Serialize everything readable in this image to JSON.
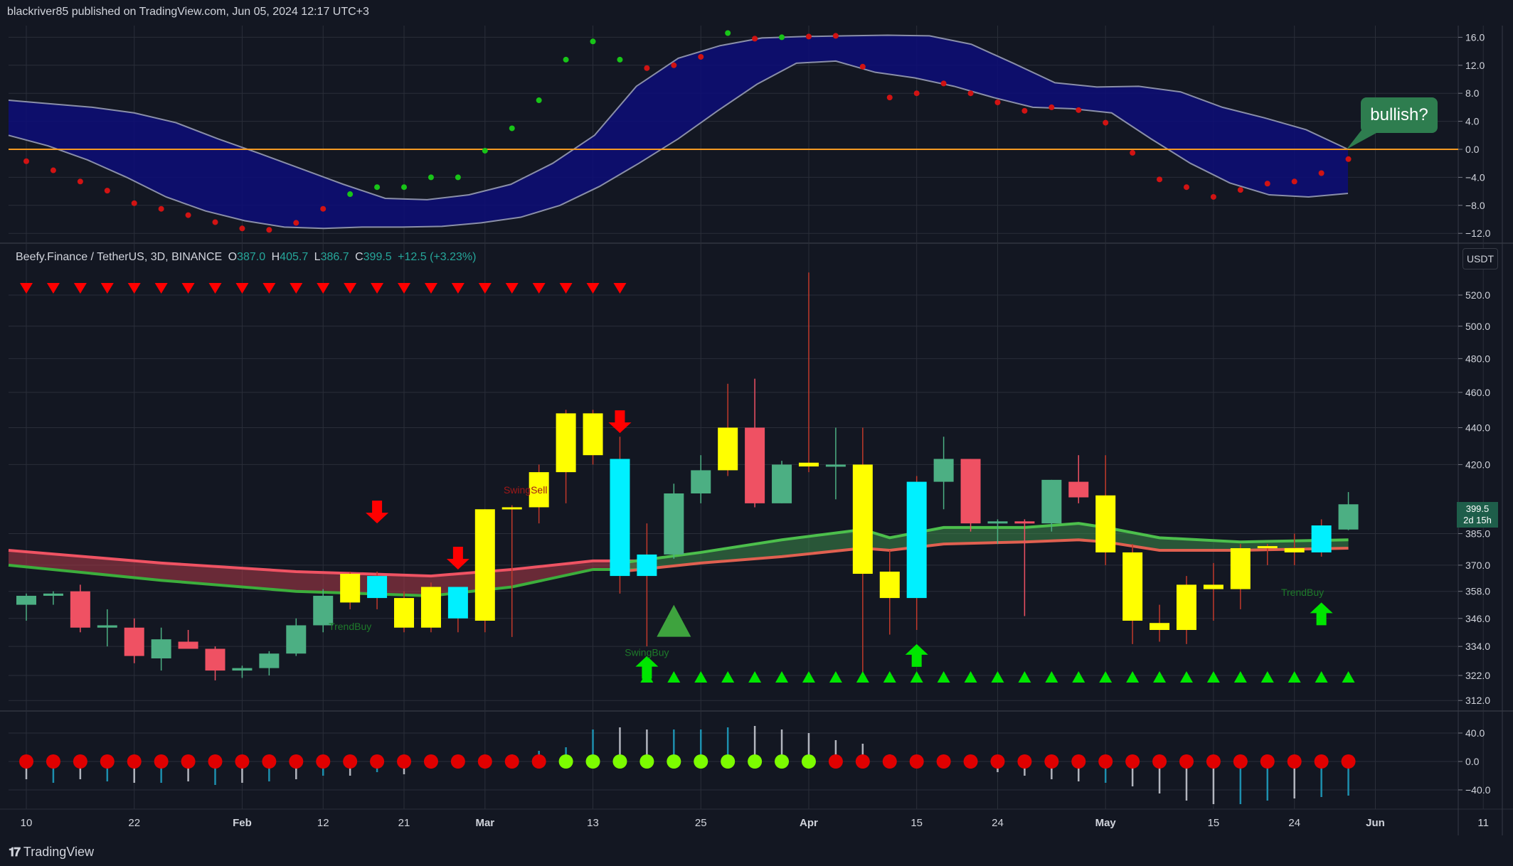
{
  "header": {
    "attribution": "blackriver85 published on TradingView.com, Jun 05, 2024 12:17 UTC+3"
  },
  "legend": {
    "symbol": "Beefy.Finance / TetherUS, 3D, BINANCE",
    "o_label": "O",
    "o_value": "387.0",
    "h_label": "H",
    "h_value": "405.7",
    "l_label": "L",
    "l_value": "386.7",
    "c_label": "C",
    "c_value": "399.5",
    "change": "+12.5 (+3.23%)"
  },
  "currency_button": "USDT",
  "annotation": "bullish?",
  "last_price": {
    "price": "399.5",
    "countdown": "2d 15h"
  },
  "footer": {
    "brand": "TradingView"
  },
  "colors": {
    "background": "#131722",
    "grid": "#2a2e39",
    "bull": "#4caf83",
    "bear": "#ef5163",
    "yellow": "#ffff00",
    "cyan": "#00f0ff",
    "cloud": "#0d0d78",
    "zero_line": "#f59a23",
    "arrow_red": "#ff0000",
    "arrow_green": "#00e600",
    "dot_red": "#e00000",
    "dot_green": "#7cfc00"
  },
  "chart_data": [
    {
      "type": "line",
      "panel": "oscillator",
      "y_ticks": [
        "16.0",
        "12.0",
        "8.0",
        "4.0",
        "0.0",
        "−4.0",
        "−8.0",
        "−12.0"
      ],
      "y_tick_values": [
        16,
        12,
        8,
        4,
        0,
        -4,
        -8,
        -12
      ],
      "ylim": [
        -12.5,
        16.5
      ],
      "x": [
        0,
        2,
        4,
        6,
        8,
        10,
        12,
        14,
        16,
        18,
        20,
        22,
        24,
        26,
        28,
        30,
        32,
        34,
        36,
        38,
        40,
        42,
        44,
        46,
        48,
        50
      ],
      "series": [
        {
          "role": "upper",
          "values": [
            7,
            6.5,
            6,
            5.2,
            3.8,
            1.5,
            -0.6,
            -2.8,
            -5,
            -7,
            -7.2,
            -6.5,
            -5,
            -2,
            2,
            9,
            13,
            14.8,
            15.9,
            16.1,
            16.2,
            16.3,
            16.2,
            15,
            12.3,
            9.5,
            8.9,
            9,
            8.2,
            6,
            4.5,
            2.8,
            0
          ]
        },
        {
          "role": "lower",
          "values": [
            2,
            0.5,
            -1.5,
            -4,
            -6.8,
            -8.8,
            -10.2,
            -11.1,
            -11.3,
            -11.1,
            -11.1,
            -11,
            -10.5,
            -9.7,
            -8,
            -5.3,
            -2,
            1.5,
            5.5,
            9.3,
            12.3,
            12.6,
            11,
            10.2,
            9,
            7.4,
            6,
            5.8,
            5.2,
            1.5,
            -2,
            -4.8,
            -6.5,
            -6.8,
            -6.3
          ]
        },
        {
          "role": "dots",
          "values": [
            -1.7,
            -3,
            -4.6,
            -5.9,
            -7.7,
            -8.5,
            -9.4,
            -10.4,
            -11.3,
            -11.5,
            -10.5,
            -8.5,
            -6.4,
            -5.4,
            -5.4,
            -4,
            -4,
            -0.2,
            3,
            7,
            12.8,
            15.4,
            12.8,
            11.6,
            12,
            13.2,
            16.6,
            15.8,
            16,
            16.1,
            16.2,
            11.8,
            7.4,
            8,
            9.4,
            8,
            6.7,
            5.5,
            6,
            5.6,
            3.8,
            -0.5,
            -4.3,
            -5.4,
            -6.8,
            -5.8,
            -4.9,
            -4.6,
            -3.4,
            -1.4
          ],
          "colors_up": [
            0,
            0,
            0,
            0,
            0,
            0,
            0,
            0,
            0,
            0,
            0,
            0,
            1,
            1,
            1,
            1,
            1,
            1,
            1,
            1,
            1,
            1,
            1,
            0,
            0,
            0,
            1,
            0,
            1,
            0,
            0,
            0,
            0,
            0,
            0,
            0,
            0,
            0,
            0,
            0,
            0,
            0,
            0,
            0,
            0,
            0,
            0,
            0,
            0,
            0
          ]
        }
      ]
    },
    {
      "type": "candlestick",
      "panel": "price",
      "y_ticks": [
        "520.0",
        "500.0",
        "480.0",
        "460.0",
        "440.0",
        "420.0",
        "385.0",
        "370.0",
        "358.0",
        "346.0",
        "334.0",
        "322.0",
        "312.0"
      ],
      "y_tick_values": [
        520,
        500,
        480,
        460,
        440,
        420,
        385,
        370,
        358,
        346,
        334,
        322,
        312
      ],
      "y_scale": "log",
      "ylim": [
        308,
        535
      ],
      "x_ticks": [
        "10",
        "22",
        "Feb",
        "12",
        "21",
        "Mar",
        "13",
        "25",
        "Apr",
        "15",
        "24",
        "May",
        "15",
        "24",
        "Jun",
        "11"
      ],
      "x_tick_index": [
        0,
        4,
        8,
        11,
        14,
        17,
        21,
        25,
        29,
        33,
        36,
        40,
        44,
        47,
        50,
        54
      ],
      "candles": [
        {
          "o": 352,
          "h": 357,
          "l": 345,
          "c": 356,
          "k": "g"
        },
        {
          "o": 356,
          "h": 358,
          "l": 352,
          "c": 357,
          "k": "g"
        },
        {
          "o": 358,
          "h": 361,
          "l": 340,
          "c": 342,
          "k": "r"
        },
        {
          "o": 342,
          "h": 350,
          "l": 334,
          "c": 343,
          "k": "g"
        },
        {
          "o": 342,
          "h": 346,
          "l": 327,
          "c": 330,
          "k": "r"
        },
        {
          "o": 329,
          "h": 342,
          "l": 324,
          "c": 337,
          "k": "g"
        },
        {
          "o": 336,
          "h": 341,
          "l": 333,
          "c": 333,
          "k": "r"
        },
        {
          "o": 333,
          "h": 334,
          "l": 320,
          "c": 324,
          "k": "r"
        },
        {
          "o": 324,
          "h": 326,
          "l": 321,
          "c": 325,
          "k": "g"
        },
        {
          "o": 325,
          "h": 332,
          "l": 322,
          "c": 331,
          "k": "g"
        },
        {
          "o": 331,
          "h": 346,
          "l": 330,
          "c": 343,
          "k": "g"
        },
        {
          "o": 343,
          "h": 359,
          "l": 340,
          "c": 356,
          "k": "g"
        },
        {
          "o": 353,
          "h": 367,
          "l": 350,
          "c": 366,
          "k": "y"
        },
        {
          "o": 355,
          "h": 367,
          "l": 350,
          "c": 365,
          "k": "c"
        },
        {
          "o": 355,
          "h": 358,
          "l": 340,
          "c": 342,
          "k": "y"
        },
        {
          "o": 342,
          "h": 362,
          "l": 340,
          "c": 360,
          "k": "y"
        },
        {
          "o": 346,
          "h": 360,
          "l": 340,
          "c": 360,
          "k": "c"
        },
        {
          "o": 345,
          "h": 397,
          "l": 340,
          "c": 397,
          "k": "y"
        },
        {
          "o": 397,
          "h": 399,
          "l": 338,
          "c": 398,
          "k": "y"
        },
        {
          "o": 398,
          "h": 420,
          "l": 390,
          "c": 416,
          "k": "y"
        },
        {
          "o": 416,
          "h": 450,
          "l": 400,
          "c": 448,
          "k": "y"
        },
        {
          "o": 448,
          "h": 450,
          "l": 420,
          "c": 425,
          "k": "y"
        },
        {
          "o": 423,
          "h": 435,
          "l": 357,
          "c": 365,
          "k": "c"
        },
        {
          "o": 365,
          "h": 390,
          "l": 334,
          "c": 375,
          "k": "c"
        },
        {
          "o": 375,
          "h": 410,
          "l": 373,
          "c": 405,
          "k": "g"
        },
        {
          "o": 405,
          "h": 425,
          "l": 400,
          "c": 417,
          "k": "g"
        },
        {
          "o": 417,
          "h": 465,
          "l": 414,
          "c": 440,
          "k": "y"
        },
        {
          "o": 440,
          "h": 468,
          "l": 398,
          "c": 400,
          "k": "r"
        },
        {
          "o": 400,
          "h": 422,
          "l": 400,
          "c": 420,
          "k": "g"
        },
        {
          "o": 419,
          "h": 535,
          "l": 416,
          "c": 421,
          "k": "y"
        },
        {
          "o": 420,
          "h": 440,
          "l": 402,
          "c": 420,
          "k": "g"
        },
        {
          "o": 420,
          "h": 440,
          "l": 322,
          "c": 366,
          "k": "y"
        },
        {
          "o": 367,
          "h": 377,
          "l": 339,
          "c": 355,
          "k": "y"
        },
        {
          "o": 355,
          "h": 414,
          "l": 341,
          "c": 411,
          "k": "c"
        },
        {
          "o": 411,
          "h": 435,
          "l": 397,
          "c": 423,
          "k": "g"
        },
        {
          "o": 423,
          "h": 423,
          "l": 386,
          "c": 390,
          "k": "r"
        },
        {
          "o": 390,
          "h": 392,
          "l": 380,
          "c": 391,
          "k": "g"
        },
        {
          "o": 391,
          "h": 392,
          "l": 347,
          "c": 390,
          "k": "r"
        },
        {
          "o": 390,
          "h": 412,
          "l": 386,
          "c": 412,
          "k": "g"
        },
        {
          "o": 411,
          "h": 425,
          "l": 400,
          "c": 403,
          "k": "r"
        },
        {
          "o": 404,
          "h": 425,
          "l": 370,
          "c": 376,
          "k": "y"
        },
        {
          "o": 376,
          "h": 380,
          "l": 335,
          "c": 345,
          "k": "y"
        },
        {
          "o": 344,
          "h": 352,
          "l": 336,
          "c": 341,
          "k": "y"
        },
        {
          "o": 341,
          "h": 365,
          "l": 335,
          "c": 361,
          "k": "y"
        },
        {
          "o": 359,
          "h": 371,
          "l": 345,
          "c": 361,
          "k": "y"
        },
        {
          "o": 359,
          "h": 380,
          "l": 350,
          "c": 378,
          "k": "y"
        },
        {
          "o": 378,
          "h": 380,
          "l": 370,
          "c": 379,
          "k": "y"
        },
        {
          "o": 378,
          "h": 385,
          "l": 370,
          "c": 376,
          "k": "y"
        },
        {
          "o": 376,
          "h": 392,
          "l": 374,
          "c": 389,
          "k": "c"
        },
        {
          "o": 387,
          "h": 405.7,
          "l": 386.7,
          "c": 399.5,
          "k": "g"
        }
      ],
      "ribbon_red": [
        {
          "i": 0,
          "top": 377,
          "bot": 370
        },
        {
          "i": 5,
          "top": 371,
          "bot": 363
        },
        {
          "i": 10,
          "top": 367,
          "bot": 358
        },
        {
          "i": 15,
          "top": 365,
          "bot": 356
        },
        {
          "i": 18,
          "top": 368,
          "bot": 360
        },
        {
          "i": 21,
          "top": 372,
          "bot": 368
        },
        {
          "i": 23,
          "top": 372,
          "bot": 368
        }
      ],
      "ribbon_green": [
        {
          "i": 22,
          "top": 371,
          "bot": 367
        },
        {
          "i": 25,
          "top": 376,
          "bot": 371
        },
        {
          "i": 28,
          "top": 382,
          "bot": 374
        },
        {
          "i": 31,
          "top": 387,
          "bot": 378
        },
        {
          "i": 32,
          "top": 383,
          "bot": 377
        },
        {
          "i": 34,
          "top": 388,
          "bot": 380
        },
        {
          "i": 37,
          "top": 388,
          "bot": 381
        },
        {
          "i": 39,
          "top": 390,
          "bot": 382
        },
        {
          "i": 40,
          "top": 388,
          "bot": 381
        },
        {
          "i": 42,
          "top": 383,
          "bot": 377
        },
        {
          "i": 45,
          "top": 381,
          "bot": 377
        },
        {
          "i": 49,
          "top": 382,
          "bot": 378
        }
      ],
      "sell_triangles_indices": [
        0,
        1,
        2,
        3,
        4,
        5,
        6,
        7,
        8,
        9,
        10,
        11,
        12,
        13,
        14,
        15,
        16,
        17,
        18,
        19,
        20,
        21,
        22
      ],
      "buy_triangles_indices": [
        23,
        24,
        25,
        26,
        27,
        28,
        29,
        30,
        31,
        32,
        33,
        34,
        35,
        36,
        37,
        38,
        39,
        40,
        41,
        42,
        43,
        44,
        45,
        46,
        47,
        48,
        49
      ],
      "down_arrows": [
        {
          "i": 13,
          "p": 390
        },
        {
          "i": 16,
          "p": 368
        },
        {
          "i": 22,
          "p": 437
        }
      ],
      "up_arrows": [
        {
          "i": 23,
          "p": 330
        },
        {
          "i": 33,
          "p": 335
        },
        {
          "i": 48,
          "p": 353
        }
      ],
      "labels": [
        {
          "text": "TrendBuy",
          "i": 12,
          "p": 341
        },
        {
          "text": "SwingSell",
          "i": 18.5,
          "p": 405
        },
        {
          "text": "SwingBuy",
          "i": 23,
          "p": 330
        },
        {
          "text": "TrendBuy",
          "i": 47.3,
          "p": 356
        }
      ],
      "big_triangle": {
        "i": 24,
        "p": 352
      }
    },
    {
      "type": "bar",
      "panel": "momentum",
      "y_ticks": [
        "40.0",
        "0.0",
        "−40.0"
      ],
      "y_tick_values": [
        40,
        0,
        -40
      ],
      "ylim": [
        -55,
        55
      ],
      "values": [
        -25,
        -30,
        -25,
        -28,
        -30,
        -30,
        -28,
        -33,
        -30,
        -28,
        -25,
        -20,
        -20,
        -15,
        -18,
        -10,
        -5,
        5,
        10,
        15,
        20,
        45,
        48,
        45,
        45,
        45,
        48,
        50,
        45,
        40,
        30,
        25,
        10,
        5,
        -5,
        -10,
        -15,
        -20,
        -25,
        -28,
        -30,
        -35,
        -45,
        -55,
        -60,
        -60,
        -55,
        -52,
        -50,
        -48
      ],
      "bar_colors": [
        "w",
        "c",
        "w",
        "c",
        "w",
        "c",
        "w",
        "c",
        "w",
        "c",
        "w",
        "c",
        "w",
        "c",
        "w",
        "w",
        "w",
        "c",
        "c",
        "c",
        "c",
        "c",
        "w",
        "w",
        "c",
        "c",
        "c",
        "w",
        "w",
        "w",
        "w",
        "w",
        "w",
        "w",
        "w",
        "w",
        "w",
        "w",
        "w",
        "w",
        "c",
        "w",
        "w",
        "w",
        "w",
        "c",
        "c",
        "w",
        "c",
        "c"
      ],
      "dots_green_indices": [
        20,
        21,
        22,
        23,
        24,
        25,
        26,
        27,
        28,
        29
      ]
    }
  ]
}
